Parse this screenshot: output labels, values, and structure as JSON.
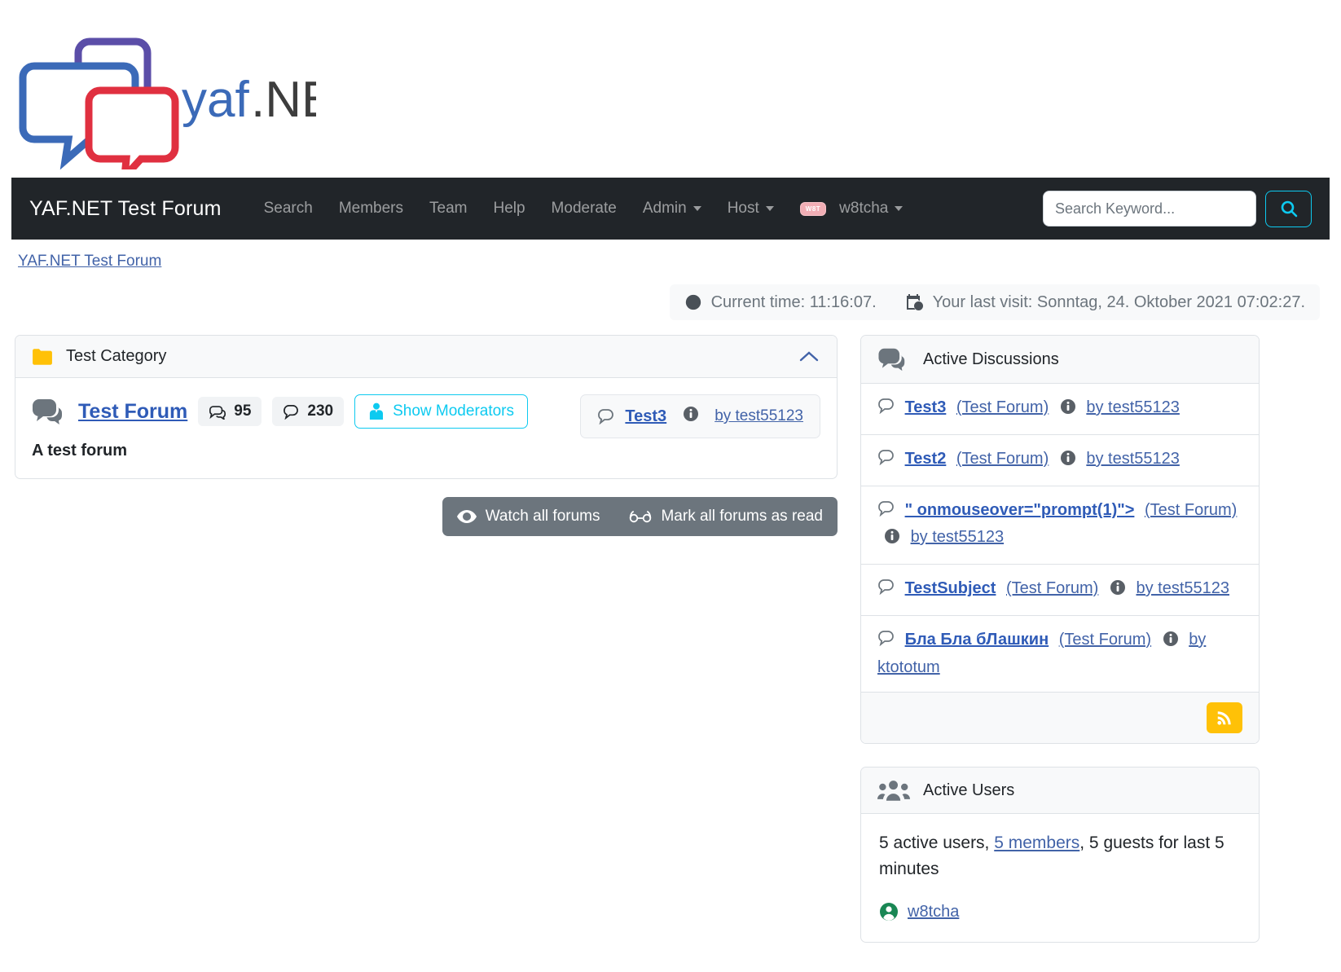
{
  "logo": {
    "text": "yaf.NET",
    "alt": "yaf-net-logo"
  },
  "navbar": {
    "brand": "YAF.NET Test Forum",
    "links": [
      {
        "label": "Search",
        "dropdown": false
      },
      {
        "label": "Members",
        "dropdown": false
      },
      {
        "label": "Team",
        "dropdown": false
      },
      {
        "label": "Help",
        "dropdown": false
      },
      {
        "label": "Moderate",
        "dropdown": false
      },
      {
        "label": "Admin",
        "dropdown": true
      },
      {
        "label": "Host",
        "dropdown": true
      }
    ],
    "user": {
      "badge": "W8T",
      "name": "w8tcha"
    },
    "search": {
      "placeholder": "Search Keyword...",
      "value": "",
      "button_icon": "search-icon"
    }
  },
  "breadcrumb": {
    "label": "YAF.NET Test Forum"
  },
  "timebar": {
    "current_time": "Current time: 11:16:07.",
    "last_visit": "Your last visit: Sonntag, 24. Oktober 2021 07:02:27."
  },
  "category": {
    "title": "Test Category",
    "folder_color": "#ffc107",
    "forum": {
      "name": "Test Forum",
      "description": "A test forum",
      "topics": "95",
      "posts": "230",
      "moderators_button": "Show Moderators",
      "last_post": {
        "topic": "Test3",
        "by": "by test55123"
      }
    }
  },
  "actions": {
    "watch_all": "Watch all forums",
    "mark_read": "Mark all forums as read"
  },
  "active_discussions": {
    "title": "Active Discussions",
    "items": [
      {
        "topic": "Test3",
        "forum": "(Test Forum)",
        "by": "by test55123"
      },
      {
        "topic": "Test2",
        "forum": "(Test Forum)",
        "by": "by test55123"
      },
      {
        "topic": "\" onmouseover=\"prompt(1)\">",
        "forum": "(Test Forum)",
        "by": "by test55123"
      },
      {
        "topic": "TestSubject",
        "forum": "(Test Forum)",
        "by": "by test55123"
      },
      {
        "topic": "Бла Бла бЛашкин",
        "forum": "(Test Forum)",
        "by": "by ktototum"
      }
    ],
    "rss_label": "rss-icon"
  },
  "active_users": {
    "title": "Active Users",
    "summary_before": "5 active users, ",
    "members_link": "5 members",
    "summary_after": ", 5 guests for last 5 minutes",
    "users": [
      {
        "name": "w8tcha"
      }
    ]
  },
  "colors": {
    "navbar_bg": "#212529",
    "link": "#2f5bb7",
    "info": "#0dcaf0",
    "warning": "#ffc107",
    "muted": "#6c757d",
    "success": "#198754"
  }
}
